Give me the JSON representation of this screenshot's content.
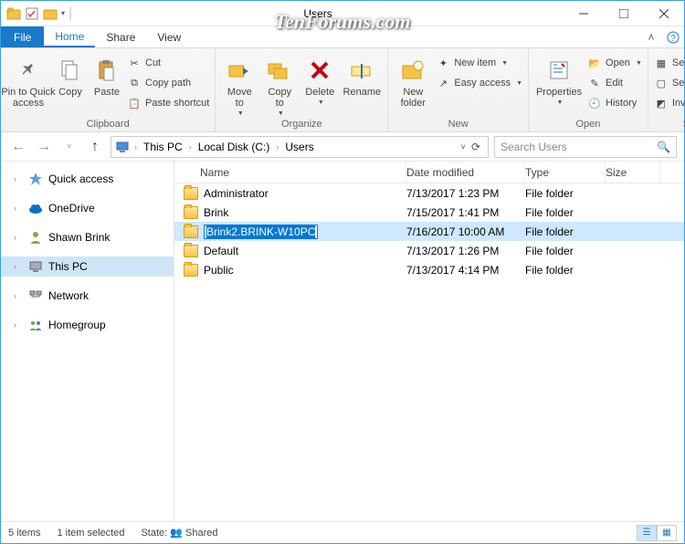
{
  "watermark": "TenForums.com",
  "titlebar": {
    "title": "Users"
  },
  "menubar": {
    "file": "File",
    "tabs": [
      "Home",
      "Share",
      "View"
    ],
    "active": 0
  },
  "ribbon": {
    "clipboard": {
      "label": "Clipboard",
      "pin": "Pin to Quick\naccess",
      "copy": "Copy",
      "paste": "Paste",
      "cut": "Cut",
      "copypath": "Copy path",
      "pasteshortcut": "Paste shortcut"
    },
    "organize": {
      "label": "Organize",
      "moveto": "Move\nto",
      "copyto": "Copy\nto",
      "delete": "Delete",
      "rename": "Rename"
    },
    "new": {
      "label": "New",
      "newfolder": "New\nfolder",
      "newitem": "New item",
      "easyaccess": "Easy access"
    },
    "open": {
      "label": "Open",
      "properties": "Properties",
      "open": "Open",
      "edit": "Edit",
      "history": "History"
    },
    "select": {
      "label": "Select",
      "selectall": "Select all",
      "selectnone": "Select none",
      "invert": "Invert selection"
    }
  },
  "breadcrumbs": [
    "This PC",
    "Local Disk (C:)",
    "Users"
  ],
  "search_placeholder": "Search Users",
  "sidebar": [
    {
      "label": "Quick access",
      "icon": "star",
      "expandable": true
    },
    {
      "label": "OneDrive",
      "icon": "cloud",
      "expandable": true
    },
    {
      "label": "Shawn Brink",
      "icon": "user",
      "expandable": true
    },
    {
      "label": "This PC",
      "icon": "pc",
      "expandable": true,
      "selected": true
    },
    {
      "label": "Network",
      "icon": "network",
      "expandable": true
    },
    {
      "label": "Homegroup",
      "icon": "homegroup",
      "expandable": true
    }
  ],
  "columns": {
    "name": "Name",
    "date": "Date modified",
    "type": "Type",
    "size": "Size"
  },
  "rows": [
    {
      "name": "Administrator",
      "date": "7/13/2017 1:23 PM",
      "type": "File folder"
    },
    {
      "name": "Brink",
      "date": "7/15/2017 1:41 PM",
      "type": "File folder"
    },
    {
      "name": "Brink2.BRINK-W10PC",
      "date": "7/16/2017 10:00 AM",
      "type": "File folder",
      "selected": true,
      "renaming": true
    },
    {
      "name": "Default",
      "date": "7/13/2017 1:26 PM",
      "type": "File folder"
    },
    {
      "name": "Public",
      "date": "7/13/2017 4:14 PM",
      "type": "File folder"
    }
  ],
  "statusbar": {
    "count": "5 items",
    "selected": "1 item selected",
    "state_label": "State:",
    "state_value": "Shared"
  }
}
